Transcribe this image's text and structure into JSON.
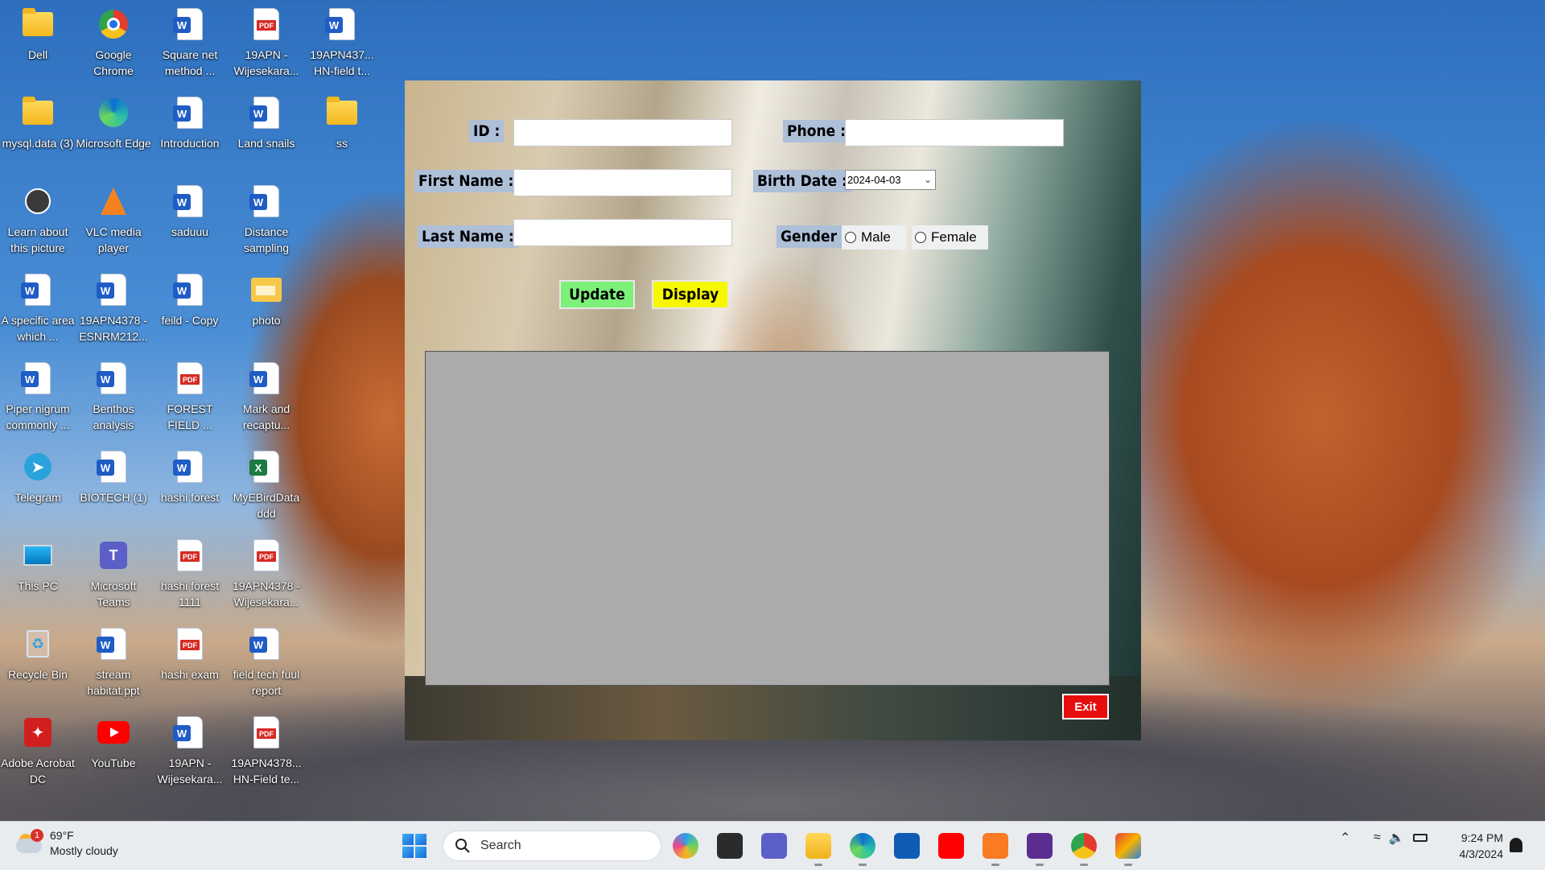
{
  "desktop": {
    "icons": [
      {
        "label": "Dell",
        "type": "folder"
      },
      {
        "label": "Google Chrome",
        "type": "chrome"
      },
      {
        "label": "Square net method ...",
        "type": "word"
      },
      {
        "label": "19APN -Wijesekara...",
        "type": "pdf"
      },
      {
        "label": "19APN437... HN-field t...",
        "type": "word"
      },
      {
        "label": "mysql.data (3)",
        "type": "folder"
      },
      {
        "label": "Microsoft Edge",
        "type": "edge"
      },
      {
        "label": "Introduction",
        "type": "word"
      },
      {
        "label": "Land snails",
        "type": "word"
      },
      {
        "label": "ss",
        "type": "folder"
      },
      {
        "label": "Learn about this picture",
        "type": "spotlight"
      },
      {
        "label": "VLC media player",
        "type": "vlc"
      },
      {
        "label": "saduuu",
        "type": "word"
      },
      {
        "label": "Distance sampling",
        "type": "word"
      },
      {
        "label": "A specific area which ...",
        "type": "word"
      },
      {
        "label": "19APN4378 -ESNRM212...",
        "type": "word"
      },
      {
        "label": "feild - Copy",
        "type": "word"
      },
      {
        "label": "photo",
        "type": "photo"
      },
      {
        "label": "Piper nigrum commonly ...",
        "type": "word"
      },
      {
        "label": "Benthos analysis",
        "type": "word"
      },
      {
        "label": "FOREST FIELD ...",
        "type": "pdf"
      },
      {
        "label": "Mark and recaptu...",
        "type": "word"
      },
      {
        "label": "Telegram",
        "type": "telegram"
      },
      {
        "label": "BIOTECH (1)",
        "type": "word"
      },
      {
        "label": "hashi forest",
        "type": "word"
      },
      {
        "label": "MyEBirdData ddd",
        "type": "excel"
      },
      {
        "label": "This PC",
        "type": "monitor"
      },
      {
        "label": "Microsoft Teams",
        "type": "teams"
      },
      {
        "label": "hashi forest 1111",
        "type": "pdf"
      },
      {
        "label": "19APN4378 -Wijesekara...",
        "type": "pdf"
      },
      {
        "label": "Recycle Bin",
        "type": "recycle"
      },
      {
        "label": "stream habitat.ppt",
        "type": "word"
      },
      {
        "label": "hashi exam",
        "type": "pdf"
      },
      {
        "label": "field tech fuul report",
        "type": "word"
      },
      {
        "label": "Adobe Acrobat DC",
        "type": "acrobat"
      },
      {
        "label": "YouTube",
        "type": "youtube"
      },
      {
        "label": "19APN -Wijesekara...",
        "type": "word"
      },
      {
        "label": "19APN4378... HN-Field te...",
        "type": "pdf"
      }
    ]
  },
  "form": {
    "id_label": "ID :",
    "phone_label": "Phone :",
    "first_name_label": "First Name :",
    "birth_date_label": "Birth Date :",
    "birth_date_value": "2024-04-03",
    "last_name_label": "Last Name :",
    "gender_label": "Gender :",
    "male_label": "Male",
    "female_label": "Female",
    "update_label": "Update",
    "display_label": "Display",
    "exit_label": "Exit",
    "colors": {
      "update_bg": "#7df07a",
      "display_bg": "#f7f700",
      "exit_bg": "#e80d0d",
      "label_bg": "#aebfd8",
      "grid_bg": "#ababab"
    }
  },
  "taskbar": {
    "weather_temp": "69°F",
    "weather_desc": "Mostly cloudy",
    "weather_badge": "1",
    "search_placeholder": "Search",
    "apps": [
      "copilot-icon",
      "task-view-icon",
      "teams-icon",
      "file-explorer-icon",
      "edge-icon",
      "store-icon",
      "youtube-icon",
      "xampp-icon",
      "visual-studio-icon",
      "chrome-icon",
      "windows-forms-app-icon"
    ],
    "time": "9:24 PM",
    "date": "4/3/2024"
  }
}
